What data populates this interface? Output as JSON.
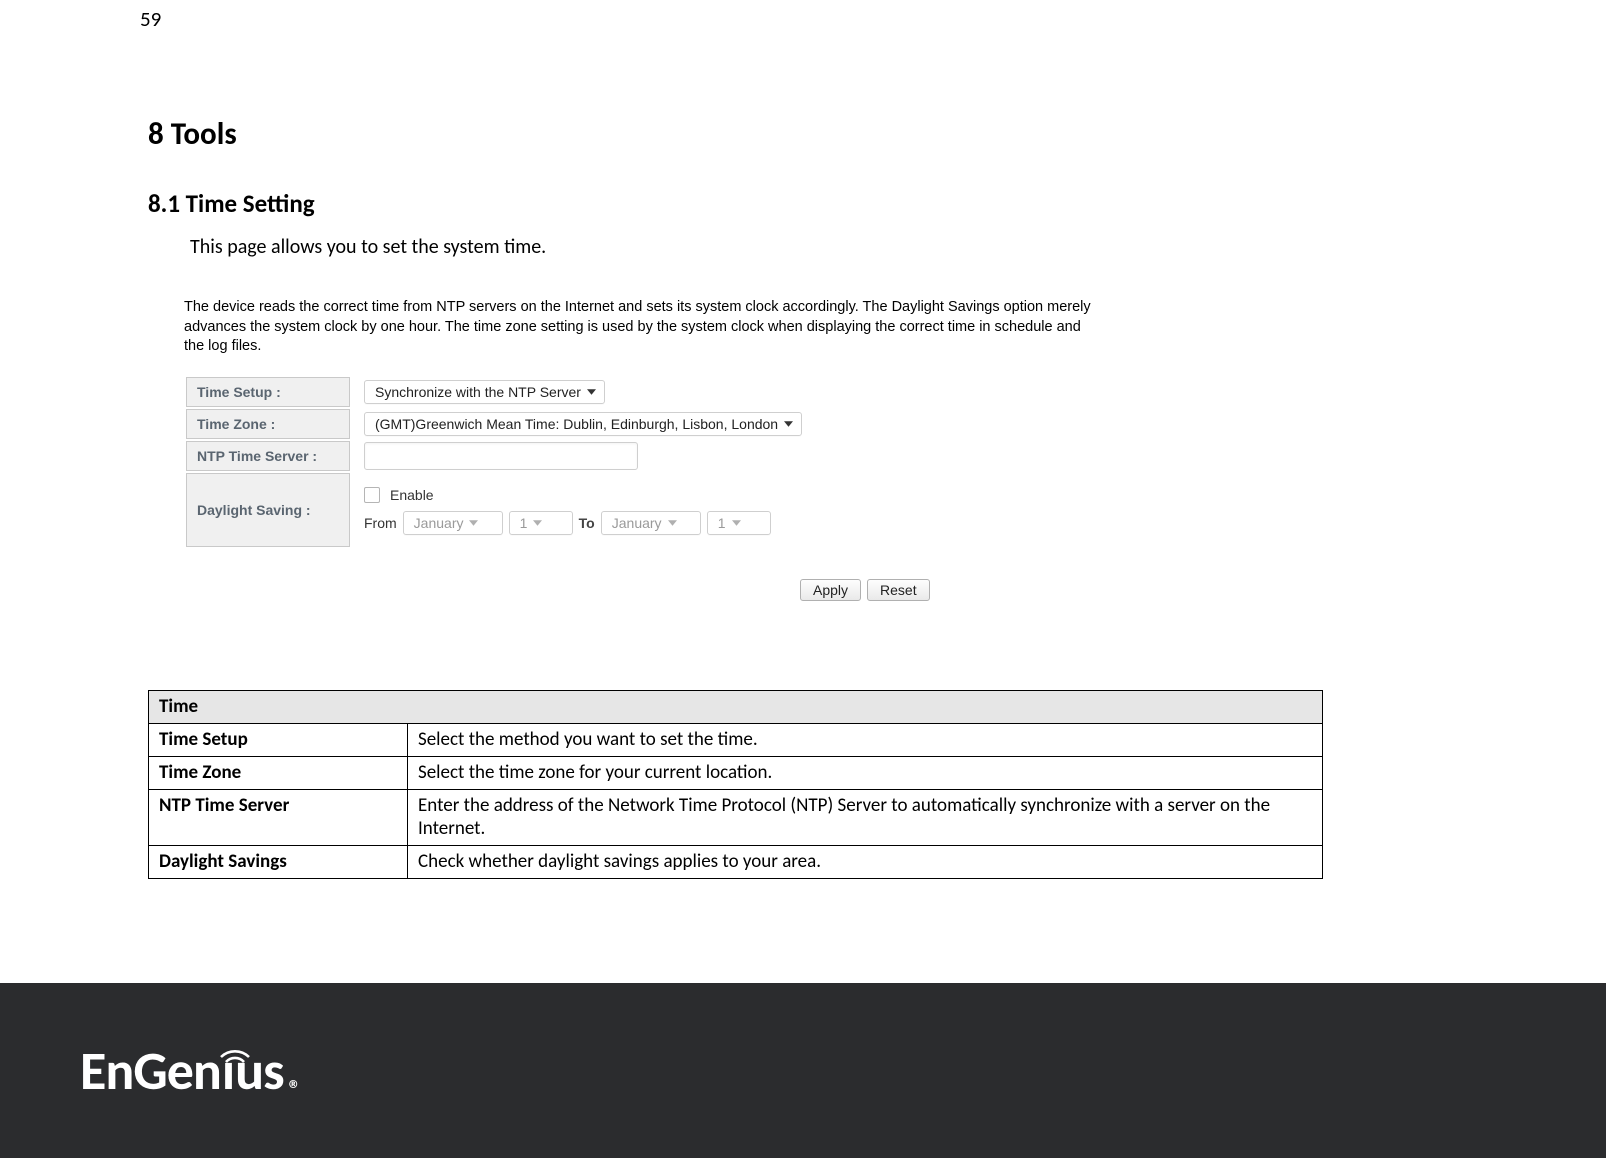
{
  "page_number": "59",
  "heading1": "8   Tools",
  "heading2": "8.1    Time Setting",
  "intro": "This page allows you to set the system time.",
  "panel": {
    "description": "The device reads the correct time from NTP servers on the Internet and sets its system clock accordingly. The Daylight Savings option merely advances the system clock by one hour. The time zone setting is used by the system clock when displaying the correct time in schedule and the log files.",
    "labels": {
      "time_setup": "Time Setup :",
      "time_zone": "Time Zone :",
      "ntp_server": "NTP Time Server :",
      "daylight_saving": "Daylight Saving :"
    },
    "values": {
      "time_setup": "Synchronize with the NTP Server",
      "time_zone": "(GMT)Greenwich Mean Time: Dublin, Edinburgh, Lisbon, London",
      "ntp_server": ""
    },
    "daylight": {
      "enable_label": "Enable",
      "enabled": false,
      "from_label": "From",
      "to_label": "To",
      "from_month": "January",
      "from_day": "1",
      "to_month": "January",
      "to_day": "1"
    },
    "buttons": {
      "apply": "Apply",
      "reset": "Reset"
    }
  },
  "desc_table": {
    "header": "Time",
    "rows": [
      {
        "key": "Time Setup",
        "val": "Select the method you want to set the time."
      },
      {
        "key": "Time Zone",
        "val": "Select the time zone for your current location."
      },
      {
        "key": "NTP Time Server",
        "val": "Enter the address of the Network Time Protocol (NTP) Server to automatically synchronize with a server on the Internet."
      },
      {
        "key": "Daylight Savings",
        "val": "Check whether daylight savings applies to your area."
      }
    ]
  },
  "logo": {
    "text_a": "EnGen",
    "text_b": "us",
    "reg": "®"
  }
}
